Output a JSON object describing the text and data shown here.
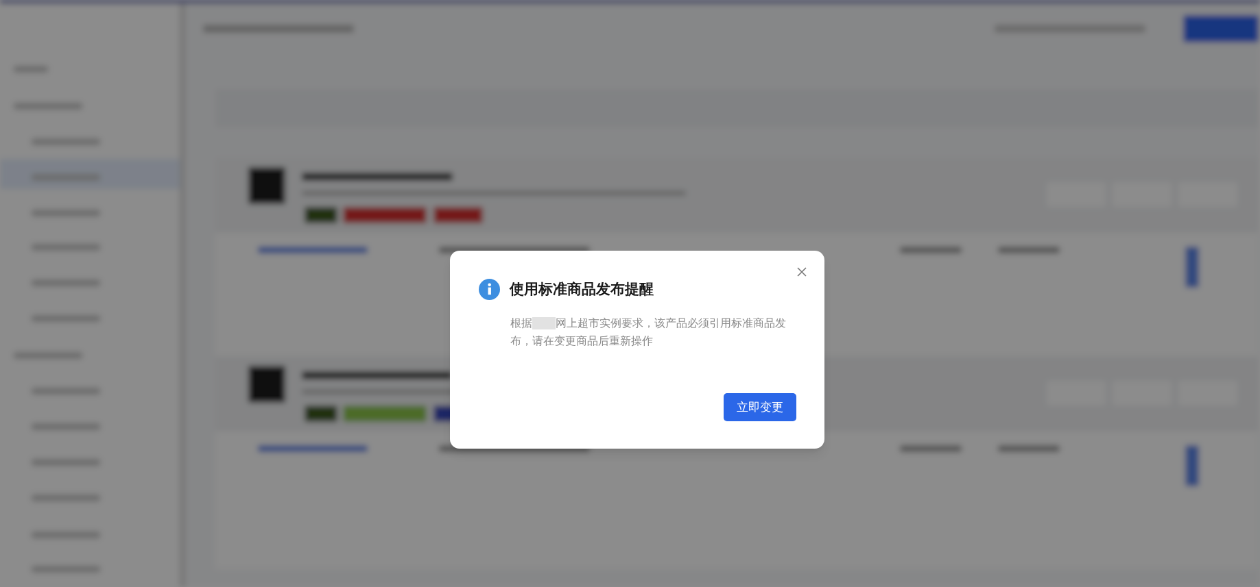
{
  "dialog": {
    "title": "使用标准商品发布提醒",
    "body_before": "根据",
    "body_after": "网上超市实例要求，该产品必须引用标准商品发布，请在变更商品后重新操作",
    "primary_button": "立即变更"
  }
}
